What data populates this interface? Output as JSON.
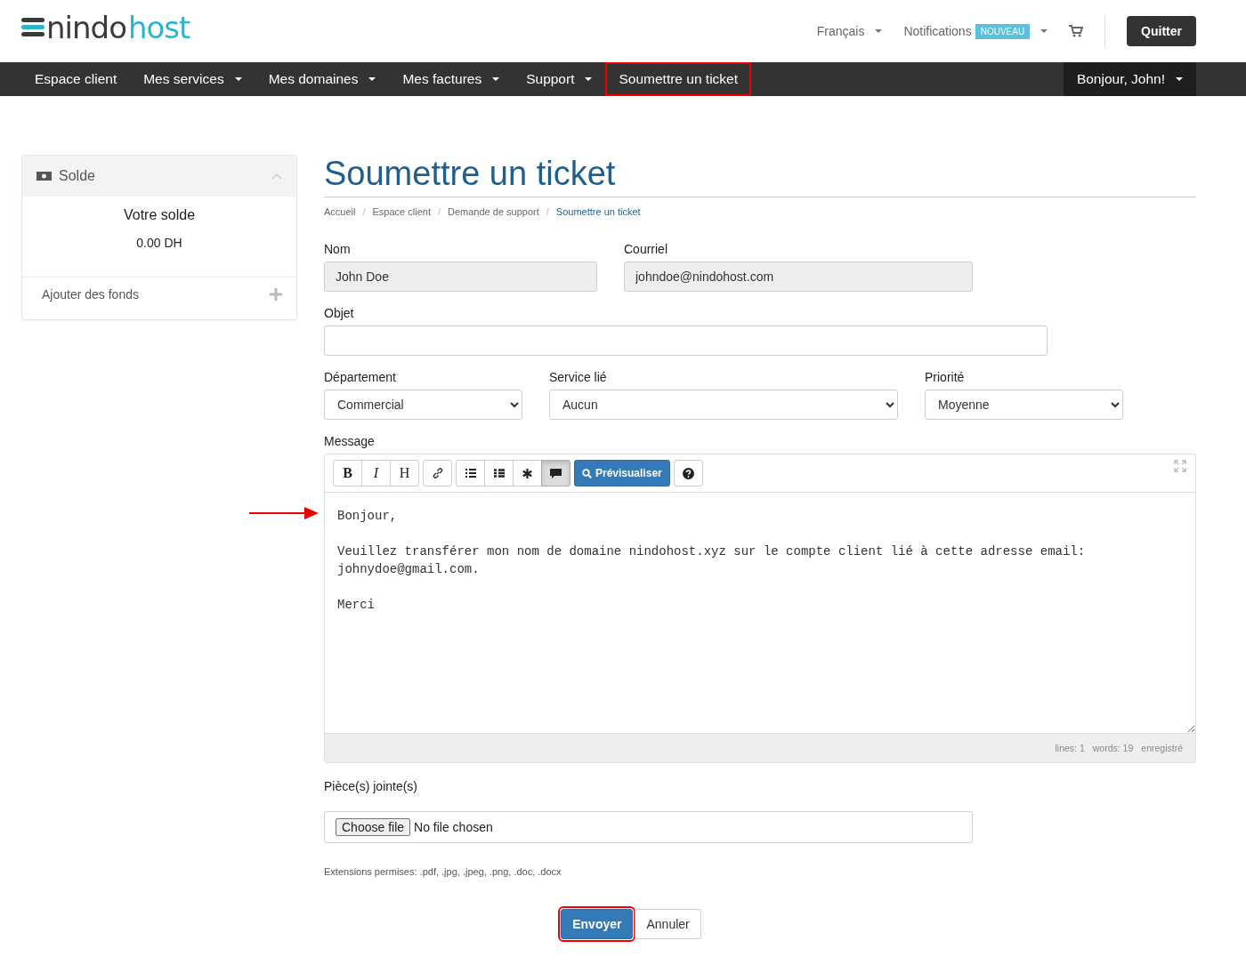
{
  "logo": {
    "part_1": "nindo",
    "part_2": "host"
  },
  "top_links": {
    "language": "Français",
    "notifications": "Notifications",
    "notifications_badge": "NOUVEAU",
    "logout": "Quitter"
  },
  "nav": [
    {
      "label": "Espace client",
      "dropdown": false,
      "highlighted": false
    },
    {
      "label": "Mes services",
      "dropdown": true,
      "highlighted": false
    },
    {
      "label": "Mes domaines",
      "dropdown": true,
      "highlighted": false
    },
    {
      "label": "Mes factures",
      "dropdown": true,
      "highlighted": false
    },
    {
      "label": "Support",
      "dropdown": true,
      "highlighted": false
    },
    {
      "label": "Soumettre un ticket",
      "dropdown": false,
      "highlighted": true
    }
  ],
  "user_menu": "Bonjour, John!",
  "sidebar": {
    "title": "Solde",
    "heading": "Votre solde",
    "balance": "0.00 DH",
    "action": "Ajouter des fonds"
  },
  "page_title": "Soumettre un ticket",
  "breadcrumb": [
    {
      "label": "Accueil",
      "selected": false
    },
    {
      "separator": "/",
      "label": "Espace client",
      "selected": false
    },
    {
      "separator": "/",
      "label": "Demande de support",
      "selected": false
    },
    {
      "separator": "/",
      "label": "Soumettre un ticket",
      "selected": true
    }
  ],
  "form": {
    "name_label": "Nom",
    "name_value": "John Doe",
    "email_label": "Courriel",
    "email_value": "johndoe@nindohost.com",
    "subject_label": "Objet",
    "department_label": "Département",
    "department_value": "Commercial",
    "service_label": "Service lié",
    "service_value": "Aucun",
    "priority_label": "Priorité",
    "priority_value": "Moyenne",
    "message_label": "Message",
    "toolbar": [
      [
        {
          "kind": "bold",
          "label": "B",
          "active": false
        },
        {
          "kind": "italic",
          "label": "I",
          "active": false
        },
        {
          "kind": "heading",
          "label": "H",
          "active": false
        }
      ],
      [
        {
          "kind": "link",
          "active": false
        }
      ],
      [
        {
          "kind": "bullet-list",
          "active": false
        },
        {
          "kind": "numbered-list",
          "active": false
        },
        {
          "kind": "asterisk",
          "active": false
        },
        {
          "kind": "comment",
          "active": true
        }
      ],
      [
        {
          "kind": "preview",
          "label": "Prévisualiser"
        }
      ],
      [
        {
          "kind": "help",
          "active": false
        }
      ]
    ],
    "message_value": "Bonjour,\n\nVeuillez transférer mon nom de domaine nindohost.xyz sur le compte client lié à cette adresse email:\njohnydoe@gmail.com.\n\nMerci",
    "status": [
      "lines: 1",
      "words: 19",
      "enregistré"
    ],
    "attachments_label": "Pièce(s) jointe(s)",
    "choose_file": "Choose file",
    "no_file": "No file chosen",
    "extensions": "Extensions permises: .pdf, .jpg, .jpeg, .png, .doc, .docx",
    "submit": {
      "label": "Envoyer",
      "highlighted": true
    },
    "cancel": {
      "label": "Annuler",
      "highlighted": false
    }
  }
}
